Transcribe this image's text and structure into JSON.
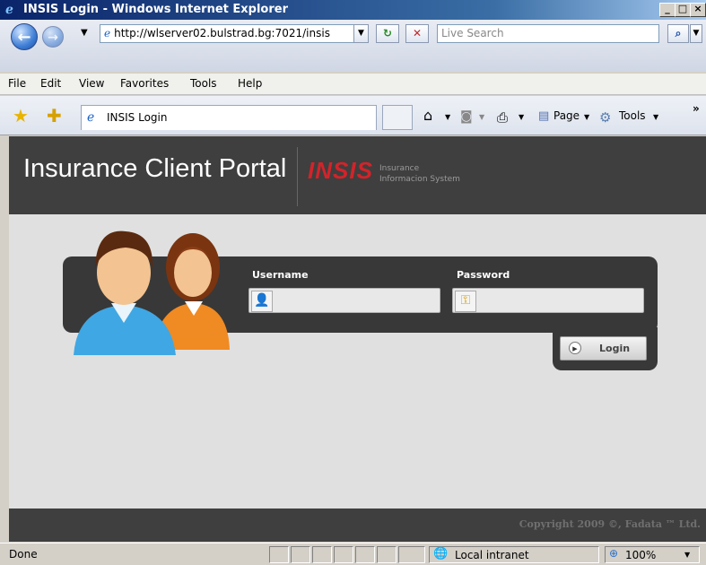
{
  "window": {
    "title": "INSIS Login - Windows Internet Explorer"
  },
  "address_bar": {
    "url": "http://wlserver02.bulstrad.bg:7021/insis",
    "search_placeholder": "Live Search"
  },
  "menu": [
    "File",
    "Edit",
    "View",
    "Favorites",
    "Tools",
    "Help"
  ],
  "tab": {
    "title": "INSIS Login"
  },
  "command_bar": {
    "page_label": "Page",
    "tools_label": "Tools"
  },
  "header": {
    "portal_title": "Insurance Client Portal",
    "logo_text": "INSIS",
    "logo_subtitle_1": "Insurance",
    "logo_subtitle_2": "Informacion System"
  },
  "login": {
    "username_label": "Username",
    "password_label": "Password",
    "username_value": "",
    "password_value": "",
    "login_button": "Login"
  },
  "footer": {
    "copyright": "Copyright 2009 ©, Fadata ™ Ltd."
  },
  "status_bar": {
    "status": "Done",
    "zone": "Local intranet",
    "zoom": "100%"
  },
  "colors": {
    "header_bg": "#3f3f3f",
    "logo_red": "#d3232a",
    "page_bg": "#e0e0e0"
  }
}
